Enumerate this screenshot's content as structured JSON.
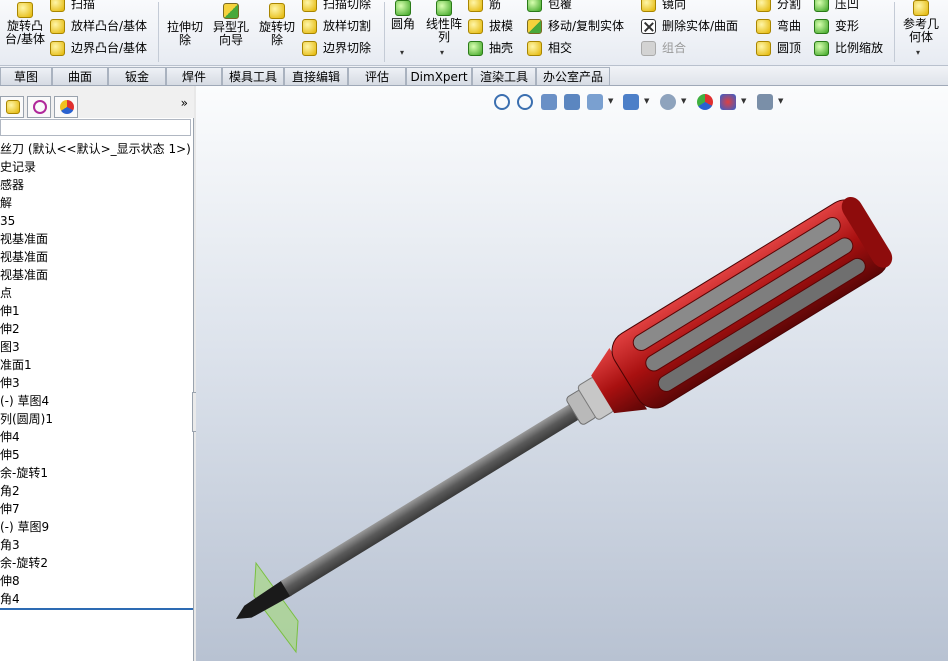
{
  "ribbon": {
    "group1": {
      "revolve_boss": "旋转凸台/基体",
      "sweep": "扫描",
      "loft_boss": "放样凸台/基体",
      "boundary_boss": "边界凸台/基体"
    },
    "group2": {
      "extruded_cut": "拉伸切除",
      "hole_wizard": "异型孔向导",
      "revolved_cut": "旋转切除",
      "swept_cut": "扫描切除",
      "lofted_cut": "放样切割",
      "boundary_cut": "边界切除"
    },
    "group3": {
      "fillet": "圆角",
      "linear_pattern": "线性阵列",
      "rib": "筋",
      "draft": "拔模",
      "shell": "抽壳",
      "wrap": "包覆",
      "move_copy": "移动/复制实体",
      "intersect": "相交",
      "mirror": "镜向",
      "delete_body": "删除实体/曲面",
      "combine": "组合",
      "split": "分割",
      "flex": "弯曲",
      "dome": "圆顶",
      "indent": "压凹",
      "deform": "变形",
      "scale": "比例缩放",
      "ref_geometry": "参考几何体"
    }
  },
  "tabs": [
    "草图",
    "曲面",
    "钣金",
    "焊件",
    "模具工具",
    "直接编辑",
    "评估",
    "DimXpert",
    "渲染工具",
    "办公室产品"
  ],
  "left_panel": {
    "expand_arrow": "»",
    "tree_items": [
      "丝刀  (默认<<默认>_显示状态 1>)",
      "史记录",
      "感器",
      "解",
      "35",
      "视基准面",
      "视基准面",
      "视基准面",
      "点",
      "伸1",
      "伸2",
      "图3",
      "准面1",
      "伸3",
      "  (-) 草图4",
      "列(圆周)1",
      "伸4",
      "伸5",
      "余-旋转1",
      "角2",
      "伸7",
      "  (-) 草图9",
      "角3",
      "余-旋转2",
      "伸8",
      "角4"
    ]
  },
  "viewport": {
    "model_name": "screwdriver",
    "handle_color": "#b01414",
    "shaft_color": "#5a5a5a",
    "plane_color": "#9be05a"
  },
  "colors": {
    "ribbon_bg": "#eef1f6",
    "viewport_top": "#fbfcfd",
    "viewport_bottom": "#b8c2d2",
    "tree_end_line": "#2d6bb3"
  }
}
